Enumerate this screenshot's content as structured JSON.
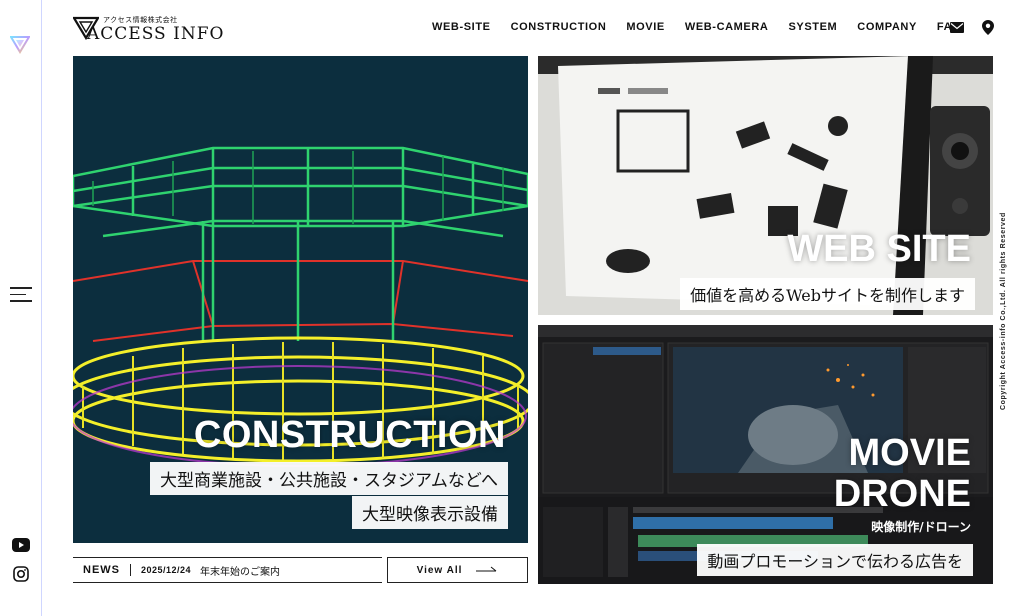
{
  "brand": {
    "subtitle": "アクセス情報株式会社",
    "name": "ACCESS INFO"
  },
  "nav": {
    "items": [
      "WEB-SITE",
      "CONSTRUCTION",
      "MOVIE",
      "WEB-CAMERA",
      "SYSTEM",
      "COMPANY",
      "FAQ"
    ],
    "icons": [
      "mail-icon",
      "map-pin-icon"
    ]
  },
  "panels": {
    "construction": {
      "title": "CONSTRUCTION",
      "line1": "大型商業施設・公共施設・スタジアムなどへ",
      "line2": "大型映像表示設備"
    },
    "website": {
      "title": "WEB SITE",
      "line1": "価値を高めるWebサイトを制作します"
    },
    "movie": {
      "title1": "MOVIE",
      "title2": "DRONE",
      "sub": "映像制作/ドローン",
      "line1": "動画プロモーションで伝わる広告を"
    }
  },
  "news": {
    "label": "NEWS",
    "date": "2025/12/24",
    "text": "年末年始のご案内",
    "view_all": "View All"
  },
  "copyright": "Copyright Access-info Co.,Ltd. All rights Reserved",
  "colors": {
    "accent_rail": "#cfd6ff",
    "wire_green": "#2fd36f",
    "wire_yellow": "#f4ef2a",
    "wire_red": "#e0322a"
  }
}
